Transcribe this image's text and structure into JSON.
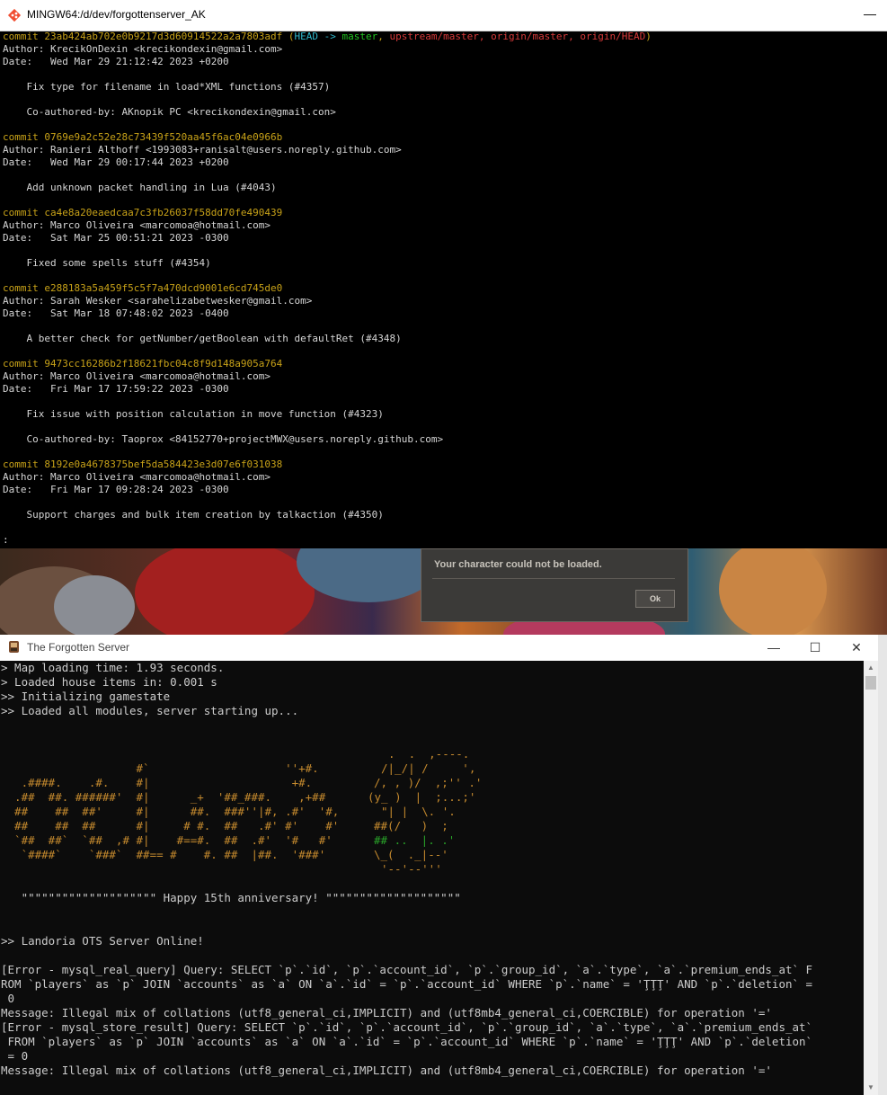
{
  "git_window": {
    "title": "MINGW64:/d/dev/forgottenserver_AK",
    "minimize_glyph": "—",
    "commits": [
      {
        "hash": "commit 23ab424ab702e0b9217d3d60914522a2a7803adf",
        "refs_open": "(",
        "ref_head": "HEAD -> ",
        "ref_master": "master",
        "ref_rest": "upstream/master, origin/master, origin/HEAD",
        "refs_close": ")",
        "author": "Author: KrecikOnDexin <krecikondexin@gmail.com>",
        "date": "Date:   Wed Mar 29 21:12:42 2023 +0200",
        "message": "    Fix type for filename in load*XML functions (#4357)",
        "coauthor": "    Co-authored-by: AKnopik PC <krecikondexin@gmail.con>"
      },
      {
        "hash": "commit 0769e9a2c52e28c73439f520aa45f6ac04e0966b",
        "author": "Author: Ranieri Althoff <1993083+ranisalt@users.noreply.github.com>",
        "date": "Date:   Wed Mar 29 00:17:44 2023 +0200",
        "message": "    Add unknown packet handling in Lua (#4043)"
      },
      {
        "hash": "commit ca4e8a20eaedcaa7c3fb26037f58dd70fe490439",
        "author": "Author: Marco Oliveira <marcomoa@hotmail.com>",
        "date": "Date:   Sat Mar 25 00:51:21 2023 -0300",
        "message": "    Fixed some spells stuff (#4354)"
      },
      {
        "hash": "commit e288183a5a459f5c5f7a470dcd9001e6cd745de0",
        "author": "Author: Sarah Wesker <sarahelizabetwesker@gmail.com>",
        "date": "Date:   Sat Mar 18 07:48:02 2023 -0400",
        "message": "    A better check for getNumber/getBoolean with defaultRet (#4348)"
      },
      {
        "hash": "commit 9473cc16286b2f18621fbc04c8f9d148a905a764",
        "author": "Author: Marco Oliveira <marcomoa@hotmail.com>",
        "date": "Date:   Fri Mar 17 17:59:22 2023 -0300",
        "message": "    Fix issue with position calculation in move function (#4323)",
        "coauthor": "    Co-authored-by: Taoprox <84152770+projectMWX@users.noreply.github.com>"
      },
      {
        "hash": "commit 8192e0a4678375bef5da584423e3d07e6f031038",
        "author": "Author: Marco Oliveira <marcomoa@hotmail.com>",
        "date": "Date:   Fri Mar 17 09:28:24 2023 -0300",
        "message": "    Support charges and bulk item creation by talkaction (#4350)"
      }
    ],
    "prompt": ":"
  },
  "game_dialog": {
    "message": "Your character could not be loaded.",
    "ok_label": "Ok"
  },
  "tfs_window": {
    "title": "The Forgotten Server",
    "minimize_glyph": "—",
    "maximize_glyph": "☐",
    "close_glyph": "✕",
    "scroll_up_glyph": "▲",
    "scroll_down_glyph": "▼",
    "lines_top": [
      "> Map loading time: 1.93 seconds.",
      "> Loaded house items in: 0.001 s",
      ">> Initializing gamestate",
      ">> Loaded all modules, server starting up..."
    ],
    "art_right": [
      ".  .  ,----.",
      "/|_/| /     ',",
      "/, , )/  ,;'' .'",
      "(y_ )  |  ;...;'",
      "\"| |  \\. '.",
      "##(/   )  ;",
      "## ..  |. .'",
      "\\_(  ._|--'",
      "'--'--'''"
    ],
    "art_left": [
      "                    #`                    ''+#.",
      "   .####.    .#.    #|                     +#.",
      "  .##  ##. ######'  #|      _+  '##_###.    ,+##",
      "  ##    ##  ##'     #|      ##.  ###''|#, .#'  '#,",
      "  ##    ##  ##      #|     # #.  ##   .#' #'    #'",
      "  `##  ##`  `##  ,# #|    #==#.  ##  .#'  '#   #'",
      "   `####`    `###`  ##== #    #. ##  |##.  '###'"
    ],
    "anniversary": "   \"\"\"\"\"\"\"\"\"\"\"\"\"\"\"\"\"\"\"\" Happy 15th anniversary! \"\"\"\"\"\"\"\"\"\"\"\"\"\"\"\"\"\"\"\"",
    "online": ">> Landoria OTS Server Online!",
    "errors": [
      "[Error - mysql_real_query] Query: SELECT `p`.`id`, `p`.`account_id`, `p`.`group_id`, `a`.`type`, `a`.`premium_ends_at` F",
      "ROM `players` as `p` JOIN `accounts` as `a` ON `a`.`id` = `p`.`account_id` WHERE `p`.`name` = 'ŢŢŢ' AND `p`.`deletion` =",
      " 0",
      "Message: Illegal mix of collations (utf8_general_ci,IMPLICIT) and (utf8mb4_general_ci,COERCIBLE) for operation '='",
      "[Error - mysql_store_result] Query: SELECT `p`.`id`, `p`.`account_id`, `p`.`group_id`, `a`.`type`, `a`.`premium_ends_at`",
      " FROM `players` as `p` JOIN `accounts` as `a` ON `a`.`id` = `p`.`account_id` WHERE `p`.`name` = 'ŢŢŢ' AND `p`.`deletion`",
      " = 0",
      "Message: Illegal mix of collations (utf8_general_ci,IMPLICIT) and (utf8mb4_general_ci,COERCIBLE) for operation '='"
    ]
  },
  "colors": {
    "commit_hash": "#c8a218",
    "ref_head": "#2fb5c9",
    "ref_master": "#1fc21f",
    "ref_remote": "#d73a3a",
    "console_text": "#cccccc",
    "console_bg": "#0c0c0c"
  }
}
